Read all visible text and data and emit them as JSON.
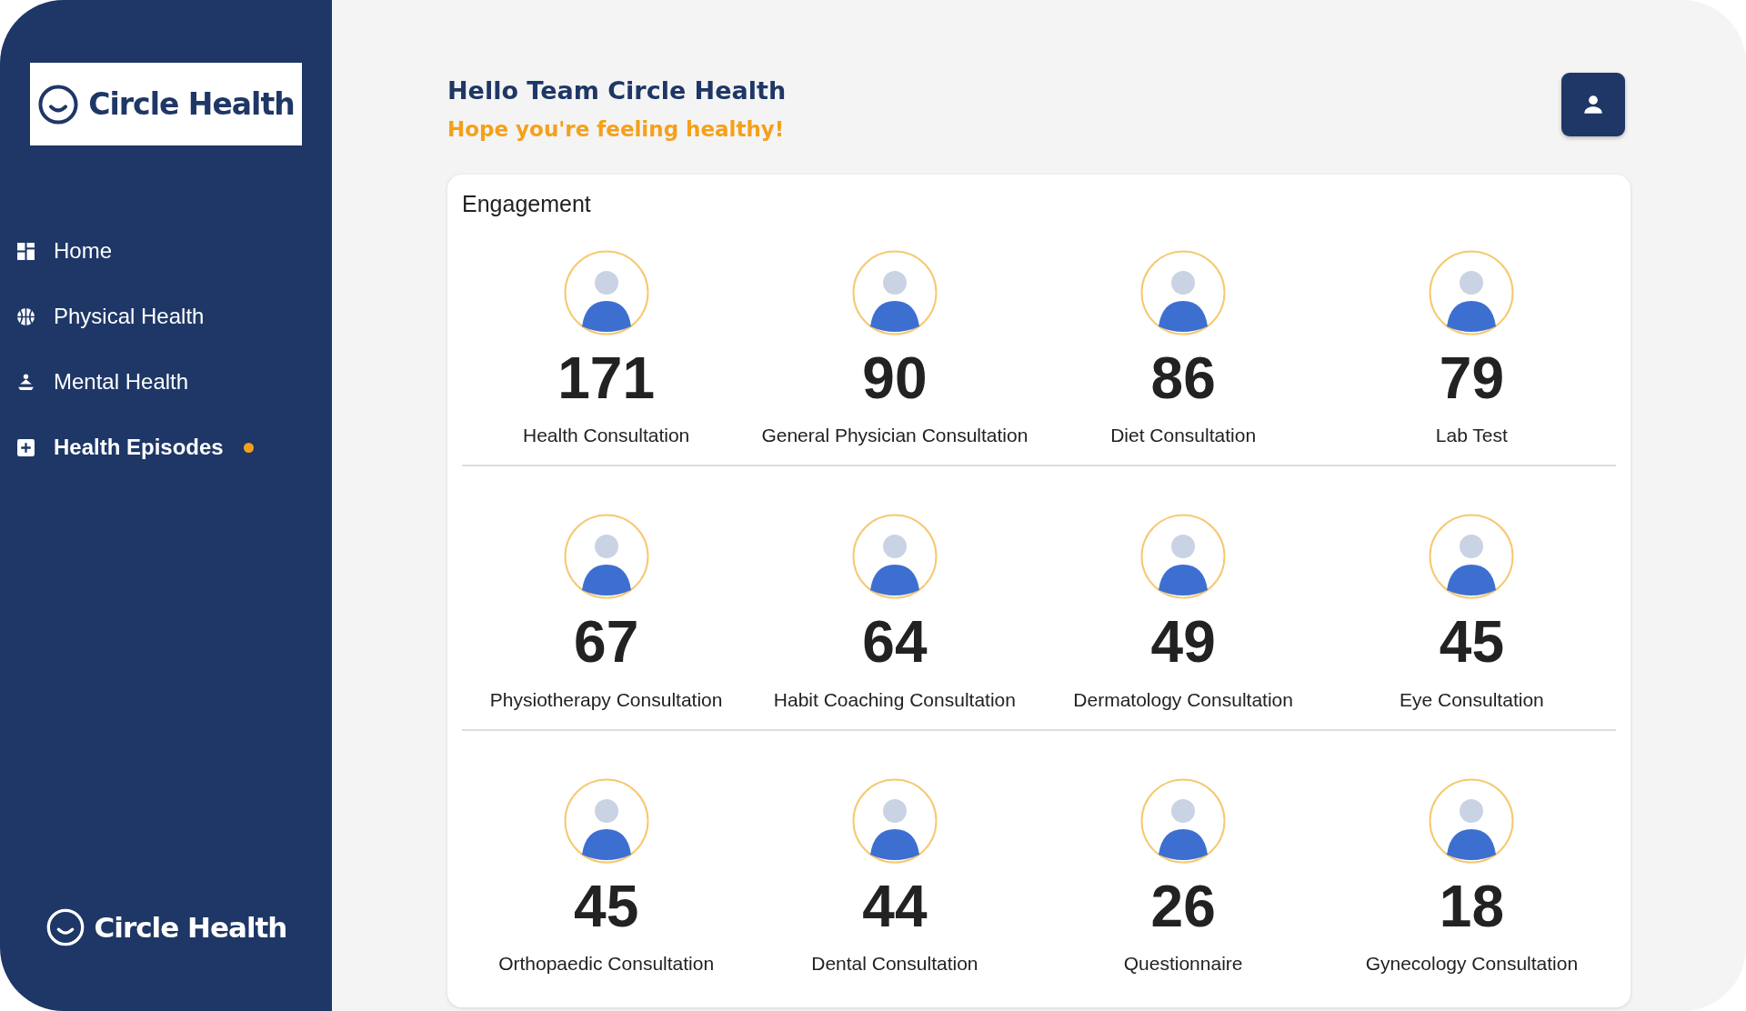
{
  "sidebar": {
    "logo": "Circle Health",
    "items": [
      {
        "label": "Home",
        "kind": "grid",
        "selected": false,
        "notification": false
      },
      {
        "label": "Physical Health",
        "kind": "ball",
        "selected": false,
        "notification": false
      },
      {
        "label": "Mental Health",
        "kind": "meditate",
        "selected": false,
        "notification": false
      },
      {
        "label": "Health Episodes",
        "kind": "plus",
        "selected": true,
        "notification": true
      }
    ],
    "footer_logo": "Circle Health"
  },
  "header": {
    "greeting": "Hello Team Circle Health",
    "subtitle": "Hope you're feeling healthy!"
  },
  "engagement": {
    "title": "Engagement",
    "rows": [
      [
        {
          "count": "171",
          "label": "Health Consultation"
        },
        {
          "count": "90",
          "label": "General Physician Consultation"
        },
        {
          "count": "86",
          "label": "Diet Consultation"
        },
        {
          "count": "79",
          "label": "Lab Test"
        }
      ],
      [
        {
          "count": "67",
          "label": "Physiotherapy Consultation"
        },
        {
          "count": "64",
          "label": "Habit Coaching Consultation"
        },
        {
          "count": "49",
          "label": "Dermatology Consultation"
        },
        {
          "count": "45",
          "label": "Eye Consultation"
        }
      ],
      [
        {
          "count": "45",
          "label": "Orthopaedic Consultation"
        },
        {
          "count": "44",
          "label": "Dental Consultation"
        },
        {
          "count": "26",
          "label": "Questionnaire"
        },
        {
          "count": "18",
          "label": "Gynecology Consultation"
        }
      ]
    ]
  }
}
